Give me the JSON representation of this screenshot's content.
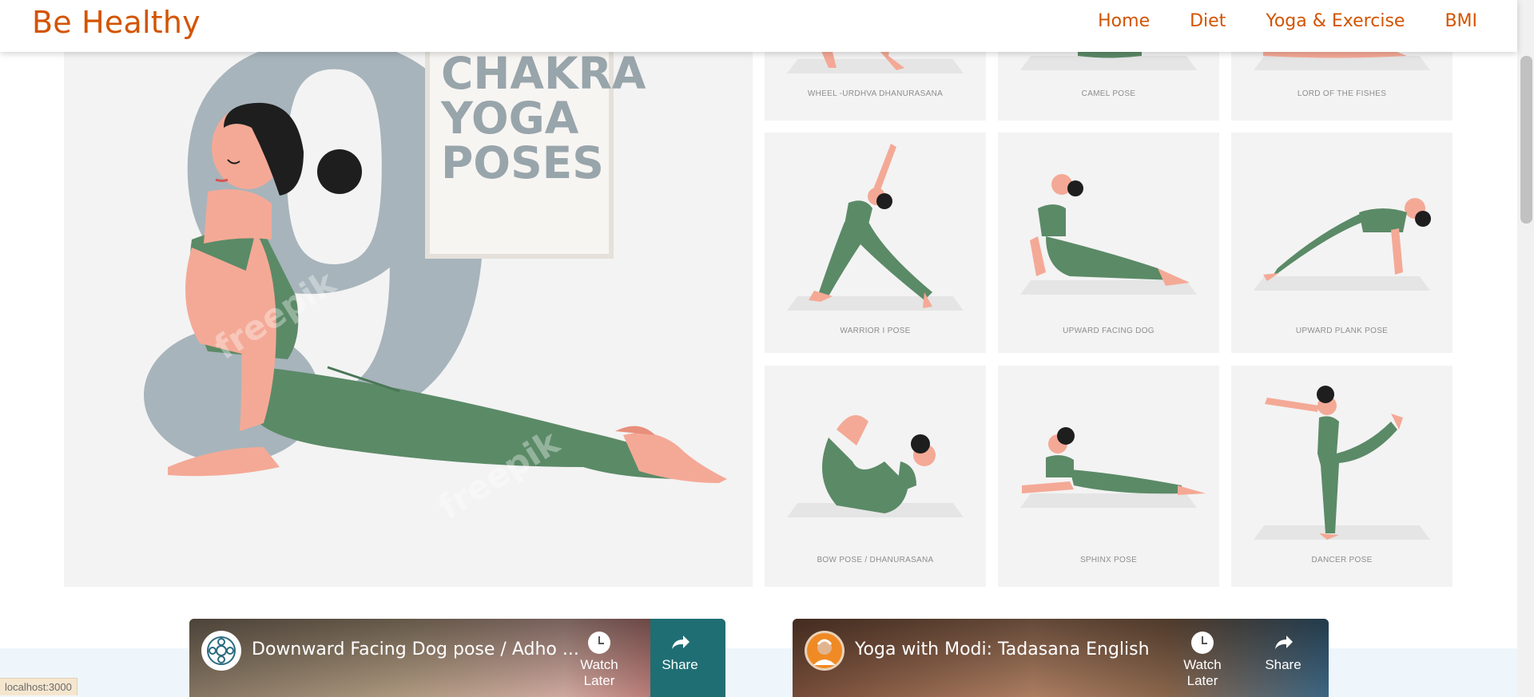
{
  "navbar": {
    "brand": "Be Healthy",
    "links": [
      "Home",
      "Diet",
      "Yoga & Exercise",
      "BMI"
    ]
  },
  "hero": {
    "title_lines": [
      "CHAKRA",
      "YOGA",
      "POSES"
    ],
    "watermark": "freepik",
    "poses": [
      "WHEEL -URDHVA DHANURASANA",
      "CAMEL POSE",
      "LORD OF THE FISHES",
      "WARRIOR I POSE",
      "UPWARD FACING DOG",
      "UPWARD PLANK POSE",
      "BOW POSE  / DHANURASANA",
      "SPHINX POSE",
      "DANCER POSE"
    ]
  },
  "videos": [
    {
      "title": "Downward Facing Dog pose / Adho ...",
      "watch_later": "Watch Later",
      "share": "Share"
    },
    {
      "title": "Yoga with Modi: Tadasana English",
      "watch_later": "Watch Later",
      "share": "Share"
    }
  ],
  "status_bar": {
    "url": "localhost:3000"
  },
  "colors": {
    "brand": "#d35400",
    "pose_green": "#5b8a67",
    "skin": "#f4a996",
    "hair": "#1e1e1e",
    "nine": "#a7b4bb"
  }
}
